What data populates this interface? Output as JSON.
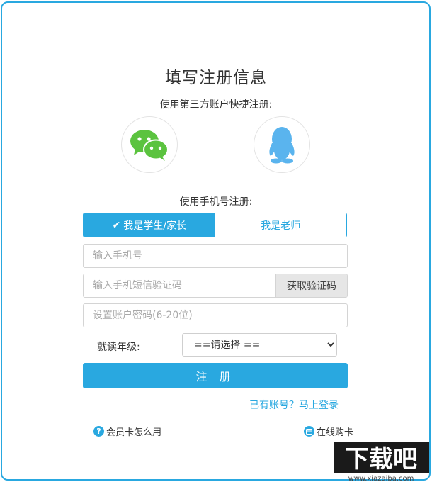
{
  "page": {
    "title": "填写注册信息",
    "third_party_label": "使用第三方账户快捷注册:",
    "phone_register_label": "使用手机号注册:"
  },
  "social": [
    {
      "name": "wechat",
      "icon": "wechat-icon"
    },
    {
      "name": "qq",
      "icon": "qq-penguin-icon"
    }
  ],
  "roles": {
    "student_parent": "我是学生/家长",
    "teacher": "我是老师",
    "selected": "student_parent"
  },
  "form": {
    "phone_placeholder": "输入手机号",
    "sms_placeholder": "输入手机短信验证码",
    "sms_button": "获取验证码",
    "password_placeholder": "设置账户密码(6-20位)",
    "grade_label": "就读年级:",
    "grade_selected": "==请选择 ==",
    "submit": "注 册"
  },
  "links": {
    "login": "已有账号？马上登录",
    "member_card_help": "会员卡怎么用",
    "buy_card": "在线购卡"
  },
  "watermark": {
    "text": "下载吧",
    "url_text": "www.xiazaiba.com"
  },
  "colors": {
    "accent": "#29a8e0",
    "wechat_green": "#5bc33f",
    "qq_blue": "#5ab4ee"
  }
}
